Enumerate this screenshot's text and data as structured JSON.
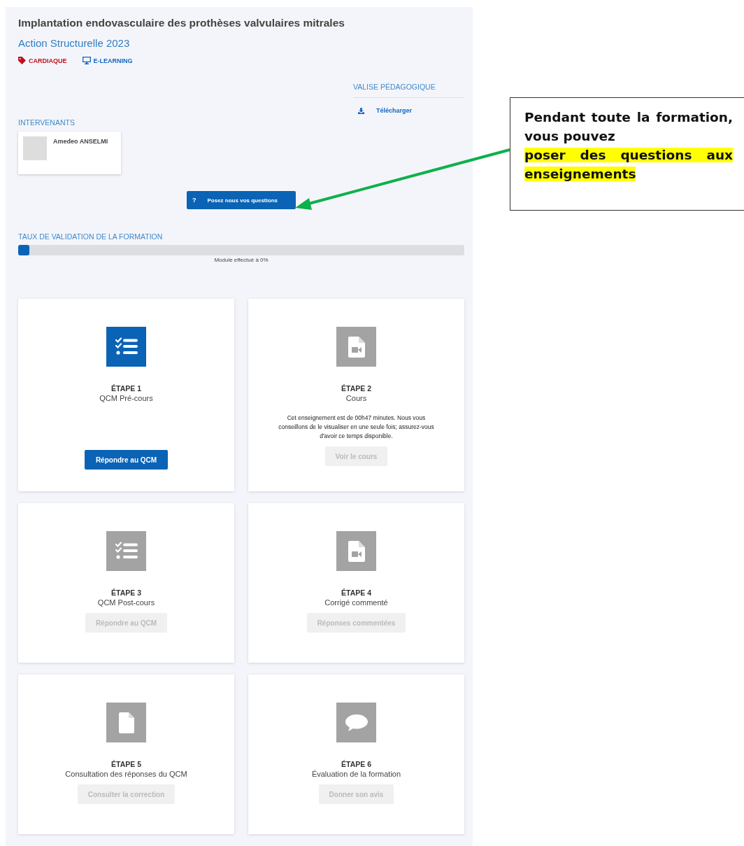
{
  "course": {
    "title": "Implantation endovasculaire des prothèses valvulaires mitrales",
    "subtitle": "Action Structurelle 2023",
    "tags": [
      {
        "label": "CARDIAQUE",
        "kind": "category",
        "color": "#c0101c"
      },
      {
        "label": "E-LEARNING",
        "kind": "format",
        "color": "#1565c0"
      }
    ]
  },
  "kit": {
    "heading": "VALISE PÉDAGOGIQUE",
    "download": "Télécharger"
  },
  "speakers": {
    "heading": "INTERVENANTS",
    "items": [
      {
        "name": "Amedeo ANSELMI"
      }
    ]
  },
  "ask_button": {
    "icon": "?",
    "label": "Posez nous vos questions"
  },
  "validation": {
    "heading": "TAUX DE VALIDATION DE LA FORMATION",
    "level": 0,
    "caption": "Module effectué à 0%"
  },
  "steps": [
    {
      "step": "ÉTAPE 1",
      "title": "QCM Pré-cours",
      "kind": "checklist",
      "enabled": true,
      "button": "Répondre au QCM"
    },
    {
      "step": "ÉTAPE 2",
      "title": "Cours",
      "kind": "video-file",
      "enabled": false,
      "note": "Cet enseignement est de 00h47 minutes. Nous vous conseillons de le visualiser en une seule fois; assurez-vous d'avoir ce temps disponible.",
      "button": "Voir le cours"
    },
    {
      "step": "ÉTAPE 3",
      "title": "QCM Post-cours",
      "kind": "checklist",
      "enabled": false,
      "button": "Répondre au QCM"
    },
    {
      "step": "ÉTAPE 4",
      "title": "Corrigé commenté",
      "kind": "video-file",
      "enabled": false,
      "button": "Réponses commentées"
    },
    {
      "step": "ÉTAPE 5",
      "title": "Consultation des réponses du QCM",
      "kind": "file",
      "enabled": false,
      "button": "Consulter la correction"
    },
    {
      "step": "ÉTAPE 6",
      "title": "Évaluation de la formation",
      "kind": "chat",
      "enabled": false,
      "button": "Donner son avis"
    }
  ],
  "annotation": {
    "parts": [
      {
        "text": "Pendant toute la formation, vous pouvez",
        "highlight": false
      },
      {
        "text": "poser des questions aux enseignements",
        "highlight": true
      }
    ]
  }
}
